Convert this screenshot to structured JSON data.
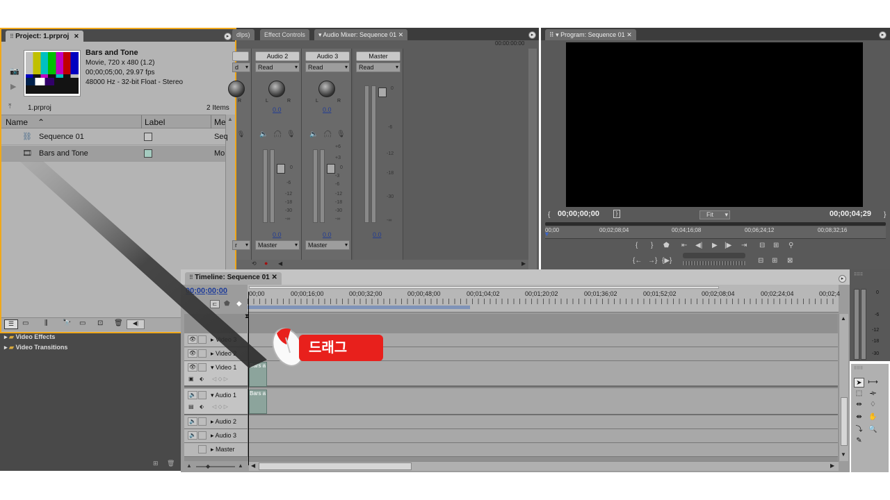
{
  "project": {
    "tab": "Project: 1.prproj",
    "clip_title": "Bars and Tone",
    "clip_line1": "Movie, 720 x 480 (1.2)",
    "clip_line2": "00;00;05;00, 29.97 fps",
    "clip_line3": "48000 Hz - 32-bit Float - Stereo",
    "proj_name": "1.prproj",
    "item_count": "2 Items",
    "col_name": "Name",
    "col_label": "Label",
    "col_media": "Me",
    "rows": [
      {
        "name": "Sequence 01",
        "media": "Seq"
      },
      {
        "name": "Bars and Tone",
        "media": "Mo"
      }
    ]
  },
  "effects": {
    "video_effects": "Video Effects",
    "video_transitions": "Video Transitions"
  },
  "mixer": {
    "tab_clips": "dlps)",
    "tab_effects": "Effect Controls",
    "tab_mixer": "Audio Mixer: Sequence 01",
    "timecode": "00:00:00:00",
    "strips": [
      {
        "label": "Audio 2",
        "mode": "Read",
        "value": "0.0",
        "out": "Master",
        "value2": "0.0"
      },
      {
        "label": "Audio 3",
        "mode": "Read",
        "value": "0.0",
        "out": "Master",
        "value2": "0.0"
      }
    ],
    "master_label": "Master",
    "master_mode": "Read",
    "master_value": "0.0",
    "partial_mode": "d",
    "partial_out": "r",
    "db_ticks": [
      "+6",
      "+3",
      "0",
      "-3",
      "-6",
      "-12",
      "-18",
      "-30",
      "-∞"
    ],
    "master_ticks": [
      "0",
      "-6",
      "-12",
      "-18",
      "-30",
      "-∞"
    ],
    "lr_l": "L",
    "lr_r": "R"
  },
  "program": {
    "tab": "Program: Sequence 01",
    "timecode_left": "00;00;00;00",
    "timecode_right": "00;00;04;29",
    "zoom": "Fit",
    "ruler": [
      "00;00",
      "00;02;08;04",
      "00;04;16;08",
      "00;06;24;12",
      "00;08;32;16"
    ]
  },
  "timeline": {
    "tab": "Timeline: Sequence 01",
    "timecode": "00;00;00;00",
    "ruler": [
      "00;00",
      "00;00;16;00",
      "00;00;32;00",
      "00;00;48;00",
      "00;01;04;02",
      "00;01;20;02",
      "00;01;36;02",
      "00;01;52;02",
      "00;02;08;04",
      "00;02;24;04",
      "00;02;4"
    ],
    "tracks": [
      "Video 3",
      "Video 2",
      "Video 1",
      "Audio 1",
      "Audio 2",
      "Audio 3",
      "Master"
    ],
    "clip_video": "Bars a",
    "clip_audio": "Bars a"
  },
  "meter": {
    "ticks": [
      "0",
      "-6",
      "-12",
      "-18",
      "-30"
    ]
  },
  "annotation": {
    "drag_label": "드래그",
    "accent": "#e8201c"
  }
}
